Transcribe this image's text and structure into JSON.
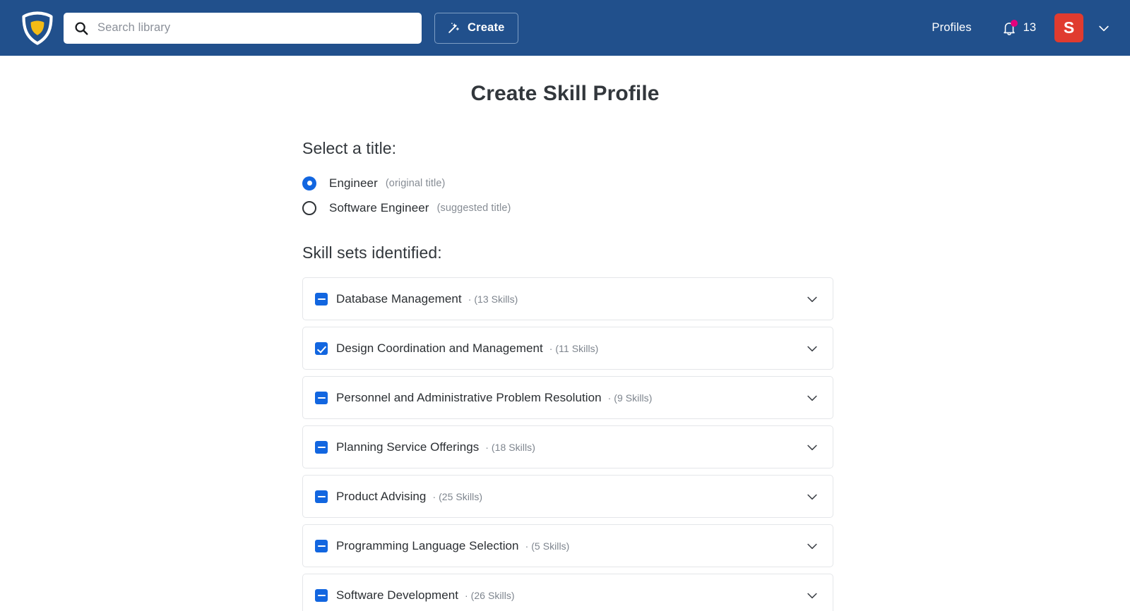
{
  "header": {
    "logo_icon": "shield-logo-icon",
    "search": {
      "icon": "search-icon",
      "placeholder": "Search library",
      "value": ""
    },
    "create_button": {
      "icon": "magic-wand-icon",
      "label": "Create"
    },
    "profiles_link": "Profiles",
    "notifications": {
      "icon": "bell-icon",
      "badge_dot_color": "#E5007D",
      "count": "13"
    },
    "avatar": {
      "initial": "S",
      "color": "#E03B2F"
    },
    "account_caret_icon": "chevron-down-icon",
    "background_color": "#21508C"
  },
  "main": {
    "page_title": "Create Skill Profile",
    "title_section": {
      "label": "Select a title:",
      "options": [
        {
          "label": "Engineer",
          "note": "(original title)",
          "selected": true
        },
        {
          "label": "Software Engineer",
          "note": "(suggested title)",
          "selected": false
        }
      ]
    },
    "skillsets_section": {
      "label": "Skill sets identified:",
      "accent_color": "#1266E0",
      "cards": [
        {
          "title": "Database Management",
          "meta": "· (13 Skills)",
          "state": "indeterminate",
          "chevron_icon": "chevron-down-icon"
        },
        {
          "title": "Design Coordination and Management",
          "meta": "· (11 Skills)",
          "state": "checked",
          "chevron_icon": "chevron-down-icon"
        },
        {
          "title": "Personnel and Administrative Problem Resolution",
          "meta": "· (9 Skills)",
          "state": "indeterminate",
          "chevron_icon": "chevron-down-icon"
        },
        {
          "title": "Planning Service Offerings",
          "meta": "· (18 Skills)",
          "state": "indeterminate",
          "chevron_icon": "chevron-down-icon"
        },
        {
          "title": "Product Advising",
          "meta": "· (25 Skills)",
          "state": "indeterminate",
          "chevron_icon": "chevron-down-icon"
        },
        {
          "title": "Programming Language Selection",
          "meta": "· (5 Skills)",
          "state": "indeterminate",
          "chevron_icon": "chevron-down-icon"
        },
        {
          "title": "Software Development",
          "meta": "· (26 Skills)",
          "state": "indeterminate",
          "chevron_icon": "chevron-down-icon"
        }
      ]
    }
  }
}
